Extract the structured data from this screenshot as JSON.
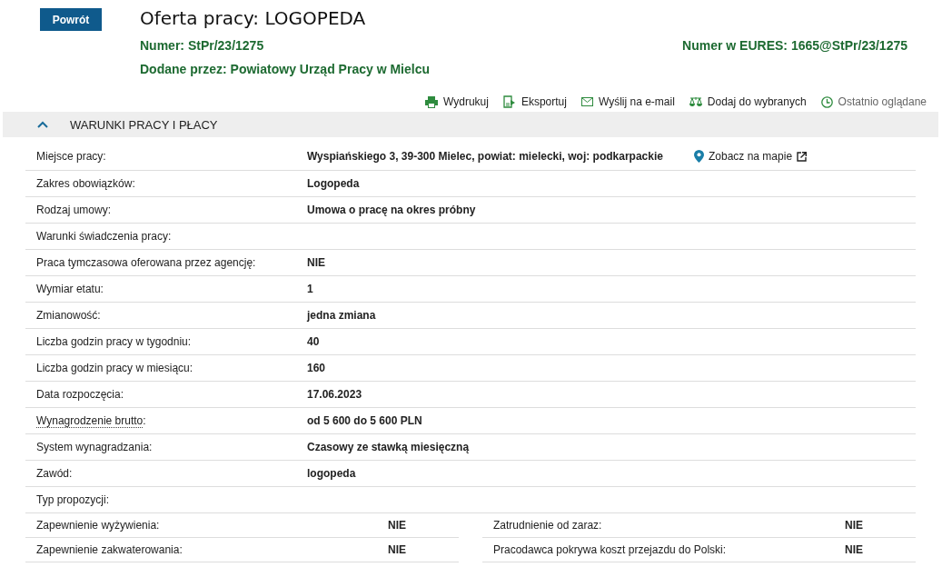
{
  "back_button": "Powrót",
  "title": "Oferta pracy: LOGOPEDA",
  "number": {
    "label": "Numer:",
    "value": "StPr/23/1275"
  },
  "eures_number": {
    "label": "Numer w EURES:",
    "value": "1665@StPr/23/1275"
  },
  "added_by": {
    "label": "Dodane przez:",
    "value": "Powiatowy Urząd Pracy w Mielcu"
  },
  "actions": [
    {
      "kind": "print",
      "label": "Wydrukuj",
      "dimmed": false
    },
    {
      "kind": "export",
      "label": "Eksportuj",
      "dimmed": false
    },
    {
      "kind": "email",
      "label": "Wyślij na e-mail",
      "dimmed": false
    },
    {
      "kind": "favorite",
      "label": "Dodaj do wybranych",
      "dimmed": false
    },
    {
      "kind": "history",
      "label": "Ostatnio oglądane",
      "dimmed": true
    }
  ],
  "section": {
    "title": "WARUNKI PRACY I PŁACY",
    "expanded": true,
    "rows": [
      {
        "label": "Miejsce pracy:",
        "value": "Wyspiańskiego 3, 39-300 Mielec, powiat: mielecki, woj: podkarpackie",
        "hint": false,
        "map_link": "Zobacz na mapie"
      },
      {
        "label": "Zakres obowiązków:",
        "value": "Logopeda",
        "hint": false
      },
      {
        "label": "Rodzaj umowy:",
        "value": "Umowa o pracę na okres próbny",
        "hint": false
      },
      {
        "label": "Warunki świadczenia pracy:",
        "hint": false
      },
      {
        "label": "Praca tymczasowa oferowana przez agencję:",
        "value": "NIE",
        "hint": false
      },
      {
        "label": "Wymiar etatu:",
        "value": "1",
        "hint": false
      },
      {
        "label": "Zmianowość:",
        "value": "jedna zmiana",
        "hint": false
      },
      {
        "label": "Liczba godzin pracy w tygodniu:",
        "value": "40",
        "hint": false
      },
      {
        "label": "Liczba godzin pracy w miesiącu:",
        "value": "160",
        "hint": false
      },
      {
        "label": "Data rozpoczęcia:",
        "value": "17.06.2023",
        "hint": false
      },
      {
        "label": "Wynagrodzenie brutto",
        "value": "od 5 600 do 5 600 PLN",
        "hint": true,
        "label_suffix": ":"
      },
      {
        "label": "System wynagradzania:",
        "value": "Czasowy ze stawką miesięczną",
        "hint": false
      },
      {
        "label": "Zawód:",
        "value": "logopeda",
        "hint": false
      },
      {
        "label": "Typ propozycji:",
        "hint": false
      }
    ],
    "pairs": [
      [
        {
          "label": "Zapewnienie wyżywienia:",
          "value": "NIE"
        },
        {
          "label": "Zatrudnienie od zaraz:",
          "value": "NIE"
        }
      ],
      [
        {
          "label": "Zapewnienie zakwaterowania:",
          "value": "NIE"
        },
        {
          "label": "Pracodawca pokrywa koszt przejazdu do Polski:",
          "value": "NIE"
        }
      ]
    ]
  }
}
